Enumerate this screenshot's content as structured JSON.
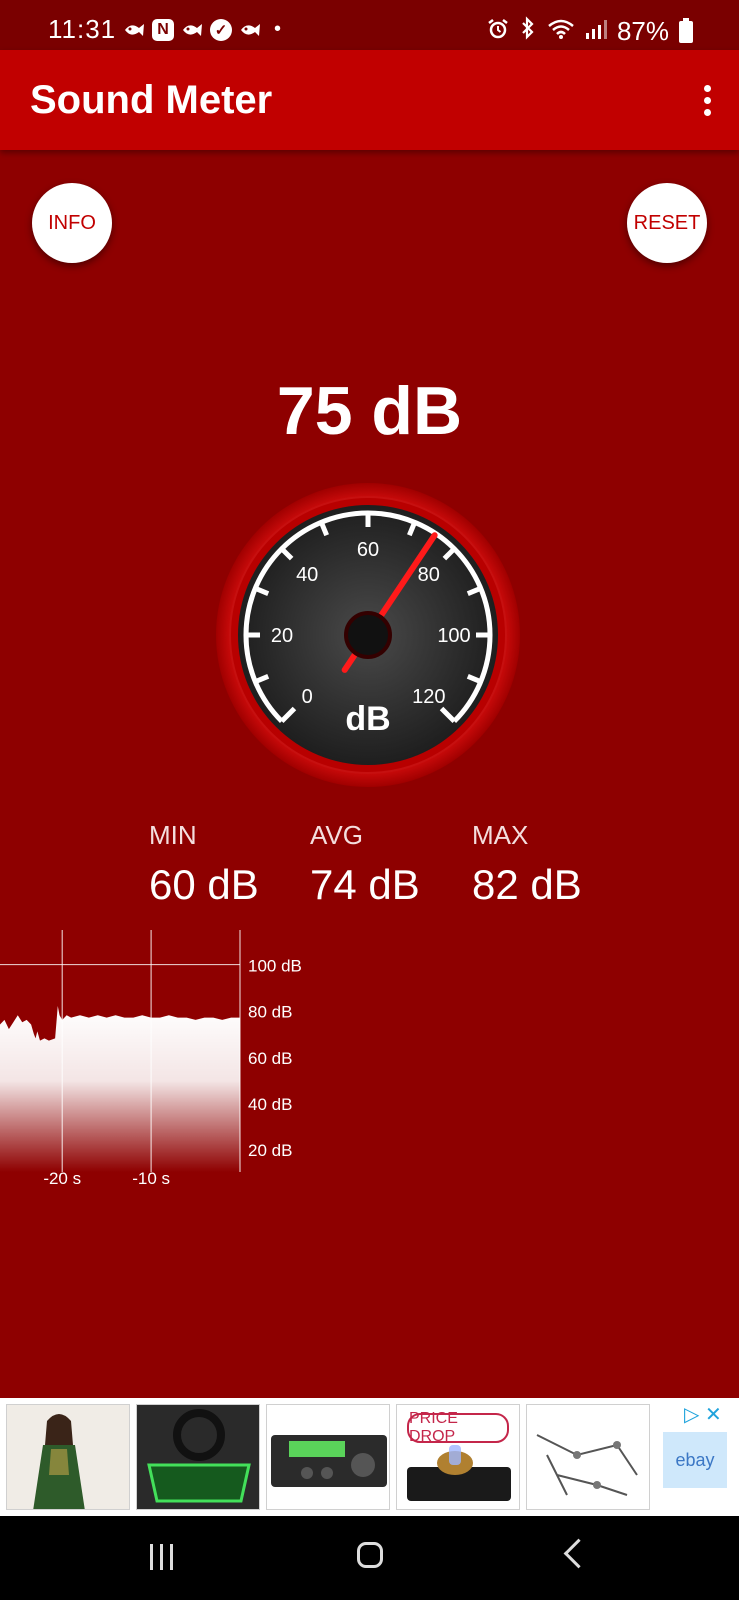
{
  "status_bar": {
    "time": "11:31",
    "notification_icons": [
      "tv-fish-icon",
      "n-box-icon",
      "fish-icon",
      "check-circle-icon",
      "fish-icon"
    ],
    "dot": "•",
    "battery_percent": "87%"
  },
  "app_bar": {
    "title": "Sound Meter"
  },
  "buttons": {
    "info": "INFO",
    "reset": "RESET"
  },
  "reading": {
    "current": "75 dB",
    "current_value": 75
  },
  "gauge": {
    "unit": "dB",
    "ticks": [
      "0",
      "20",
      "40",
      "60",
      "80",
      "100",
      "120"
    ],
    "min": 0,
    "max": 120,
    "needle_value": 75
  },
  "stats": {
    "min_label": "MIN",
    "min_value": "60 dB",
    "avg_label": "AVG",
    "avg_value": "74 dB",
    "max_label": "MAX",
    "max_value": "82 dB"
  },
  "chart_data": {
    "type": "area",
    "title": "",
    "xlabel": "",
    "ylabel": "",
    "y_ticks": [
      "100 dB",
      "80 dB",
      "60 dB",
      "40 dB",
      "20 dB"
    ],
    "x_ticks": [
      "-20 s",
      "-10 s"
    ],
    "ylim": [
      10,
      115
    ],
    "xlim": [
      -27,
      0
    ],
    "x": [
      -27,
      -26.5,
      -26,
      -25.5,
      -25,
      -24.5,
      -24,
      -23.5,
      -23.2,
      -23,
      -22.8,
      -22.5,
      -22,
      -21.5,
      -20.8,
      -20.5,
      -20.3,
      -20,
      -19.5,
      -19,
      -18,
      -17,
      -16,
      -15,
      -14,
      -13,
      -12,
      -11,
      -10,
      -9,
      -8,
      -7,
      -6,
      -5,
      -4,
      -3,
      -2,
      -1,
      0
    ],
    "values": [
      74,
      76,
      72,
      75,
      78,
      75,
      76,
      74,
      70,
      68,
      71,
      67,
      68,
      67,
      68,
      82,
      78,
      76,
      78,
      77,
      78,
      77,
      78,
      77,
      78,
      77,
      77,
      78,
      77,
      77,
      78,
      77,
      77,
      76,
      77,
      77,
      76,
      77,
      77
    ],
    "grid": true
  },
  "ad": {
    "price_drop": "PRICE DROP",
    "ebay": "ebay",
    "choices": "▷ ✕"
  }
}
